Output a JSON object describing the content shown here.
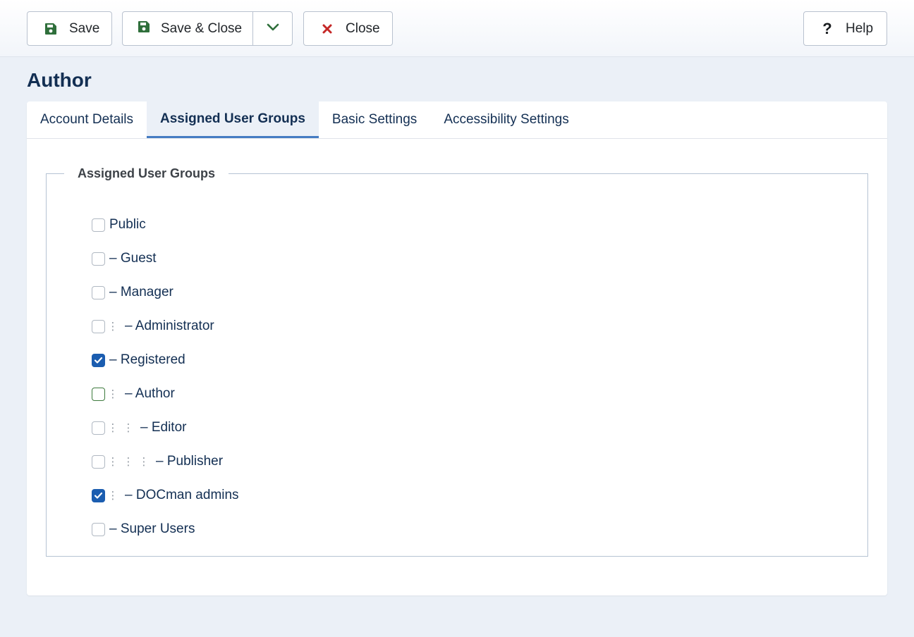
{
  "toolbar": {
    "save_label": "Save",
    "save_close_label": "Save & Close",
    "close_label": "Close",
    "help_label": "Help"
  },
  "page": {
    "title": "Author"
  },
  "tabs": [
    {
      "label": "Account Details",
      "active": false
    },
    {
      "label": "Assigned User Groups",
      "active": true
    },
    {
      "label": "Basic Settings",
      "active": false
    },
    {
      "label": "Accessibility Settings",
      "active": false
    }
  ],
  "groups": {
    "legend": "Assigned User Groups",
    "items": [
      {
        "label": "Public",
        "checked": false,
        "depth": 0
      },
      {
        "label": "– Guest",
        "checked": false,
        "depth": 0
      },
      {
        "label": "– Manager",
        "checked": false,
        "depth": 0
      },
      {
        "label": "– Administrator",
        "checked": false,
        "depth": 1
      },
      {
        "label": "– Registered",
        "checked": true,
        "depth": 0
      },
      {
        "label": "– Author",
        "checked": false,
        "depth": 1
      },
      {
        "label": "– Editor",
        "checked": false,
        "depth": 2
      },
      {
        "label": "– Publisher",
        "checked": false,
        "depth": 3
      },
      {
        "label": "– DOCman admins",
        "checked": true,
        "depth": 1
      },
      {
        "label": "– Super Users",
        "checked": false,
        "depth": 0
      }
    ]
  },
  "colors": {
    "accent": "#1b5db0",
    "save_icon": "#2f6f3b",
    "close_icon": "#c52827",
    "tab_underline": "#457cc2"
  }
}
